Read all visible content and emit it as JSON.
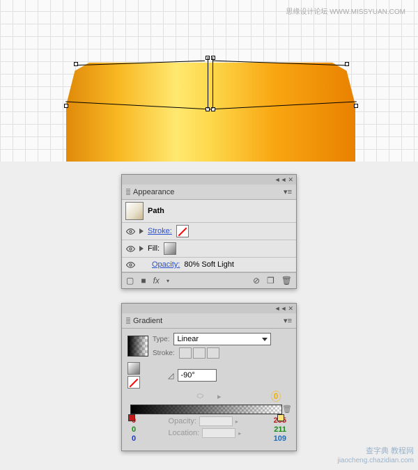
{
  "watermark_top": "思缘设计论坛  WWW.MISSYUAN.COM",
  "watermark_bottom_1": "查字典 教程网",
  "watermark_bottom_2": "jiaocheng.chazidian.com",
  "appearance": {
    "tab": "Appearance",
    "path": "Path",
    "stroke_label": "Stroke:",
    "fill_label": "Fill:",
    "opacity_label": "Opacity:",
    "opacity_value": "80% Soft Light",
    "fx": "fx"
  },
  "gradient": {
    "tab": "Gradient",
    "type_label": "Type:",
    "type_value": "Linear",
    "stroke_label": "Stroke:",
    "angle_value": "-90°",
    "opacity_label": "Opacity:",
    "location_label": "Location:",
    "yellow_zero": "0",
    "rgb_left": {
      "r": "0",
      "g": "0",
      "b": "0"
    },
    "rgb_right": {
      "r": "255",
      "g": "211",
      "b": "109"
    }
  }
}
